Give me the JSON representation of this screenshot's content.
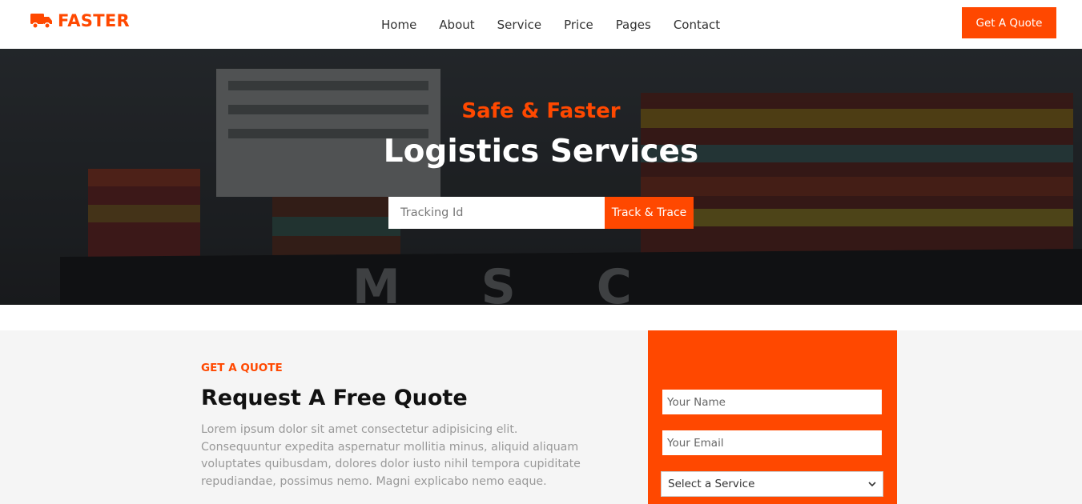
{
  "brand": {
    "name": "FASTER",
    "icon": "truck-icon",
    "color": "#FF4800"
  },
  "nav": {
    "links": [
      "Home",
      "About",
      "Service",
      "Price",
      "Pages",
      "Contact"
    ],
    "cta": "Get A Quote"
  },
  "hero": {
    "subtitle": "Safe & Faster",
    "title": "Logistics Services",
    "tracking_placeholder": "Tracking Id",
    "track_button": "Track & Trace",
    "ship_text": "M S C"
  },
  "quote": {
    "eyebrow": "GET A QUOTE",
    "title": "Request A Free Quote",
    "body": "Lorem ipsum dolor sit amet consectetur adipisicing elit. Consequuntur expedita aspernatur mollitia minus, aliquid aliquam voluptates quibusdam, dolores dolor iusto nihil tempora cupiditate repudiandae, possimus nemo. Magni explicabo nemo eaque.",
    "form": {
      "name_placeholder": "Your Name",
      "email_placeholder": "Your Email",
      "service_selected": "Select a Service"
    }
  },
  "colors": {
    "accent": "#FF4800",
    "section_bg": "#f5f5f5",
    "muted_text": "#999999"
  }
}
